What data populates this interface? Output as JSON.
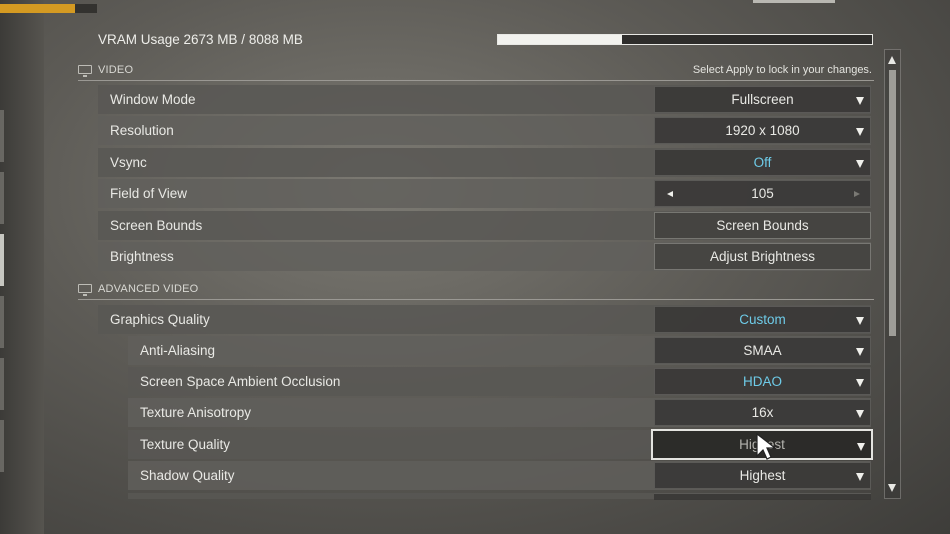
{
  "top_progress": {
    "fraction": 0.77,
    "color": "#d49a22"
  },
  "vram": {
    "label": "VRAM Usage 2673 MB / 8088 MB",
    "used_mb": 2673,
    "total_mb": 8088
  },
  "sections": {
    "video": {
      "title": "VIDEO",
      "hint": "Select Apply to lock in your changes.",
      "icon": "monitor-icon"
    },
    "advanced": {
      "title": "ADVANCED VIDEO",
      "icon": "monitor-icon"
    }
  },
  "video_rows": [
    {
      "label": "Window Mode",
      "value": "Fullscreen"
    },
    {
      "label": "Resolution",
      "value": "1920 x 1080"
    },
    {
      "label": "Vsync",
      "value": "Off"
    },
    {
      "label": "Field of View",
      "value": "105"
    },
    {
      "label": "Screen Bounds",
      "value": "Screen Bounds"
    },
    {
      "label": "Brightness",
      "value": "Adjust Brightness"
    }
  ],
  "advanced_rows": [
    {
      "label": "Graphics Quality",
      "value": "Custom"
    },
    {
      "label": "Anti-Aliasing",
      "value": "SMAA"
    },
    {
      "label": "Screen Space Ambient Occlusion",
      "value": "HDAO"
    },
    {
      "label": "Texture Anisotropy",
      "value": "16x"
    },
    {
      "label": "Texture Quality",
      "value": "Highest"
    },
    {
      "label": "Shadow Quality",
      "value": "Highest"
    }
  ],
  "colors": {
    "accent": "#6ecbe8",
    "text": "#e9e9e5"
  }
}
